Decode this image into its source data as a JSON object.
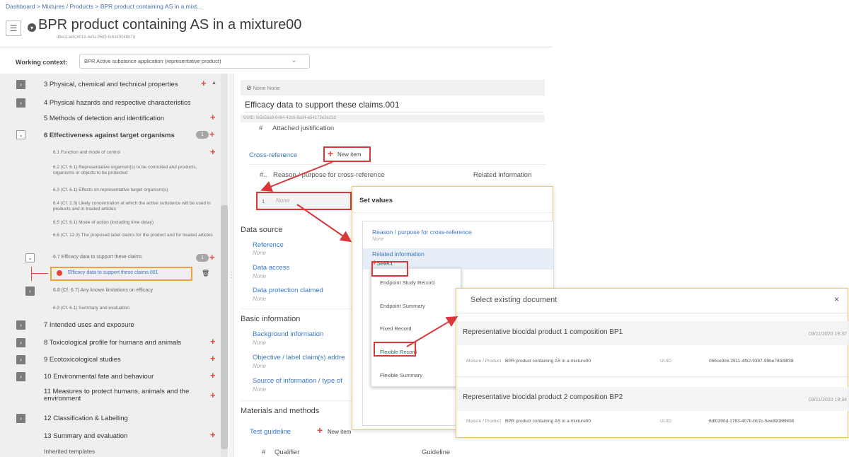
{
  "header": {
    "breadcrumb": "Dashboard > Mixtures / Products > BPR product containing AS in a mixt...",
    "title": "BPR product containing AS in a mixture00",
    "uuid": "d8ec1ae5-8018-4efa-9589-fe644004bb7d"
  },
  "context": {
    "label": "Working context:",
    "value": "BPR Active substance application (representative product)"
  },
  "sidebar": {
    "items": [
      {
        "label": "3 Physical, chemical and technical properties"
      },
      {
        "label": "4 Physical hazards and respective characteristics"
      },
      {
        "label": "5 Methods of detection and identification"
      },
      {
        "label": "6 Effectiveness against target organisms",
        "badge": "1"
      },
      {
        "label": "6.1 Function and mode of control"
      },
      {
        "label": "6.2 (Cf. 6.1) Representative organism(s) to be controlled and products, organisms or objects to be protected"
      },
      {
        "label": "6.3 (Cf. 6.1) Effects on representative target organism(s)"
      },
      {
        "label": "6.4 (Cf. 2.3) Likely concentration at which the active substance will be used in products and in treated articles"
      },
      {
        "label": "6.5 (Cf. 6.1) Mode of action (including time delay)"
      },
      {
        "label": "6.6 (Cf. 12.3) The proposed label claims for the product and for treated articles"
      },
      {
        "label": "6.7 Efficacy data to support these claims",
        "badge": "1"
      },
      {
        "label": "Efficacy data to support these claims.001"
      },
      {
        "label": "6.8 (Cf. 6.7) Any known limitations on efficacy"
      },
      {
        "label": "6.9 (Cf. 6.1) Summary and evaluation"
      },
      {
        "label": "7 Intended uses and exposure"
      },
      {
        "label": "8 Toxicological profile for humans and animals"
      },
      {
        "label": "9 Ecotoxicological studies"
      },
      {
        "label": "10 Environmental fate and behaviour"
      },
      {
        "label": "11 Measures to protect humans, animals and the environment"
      },
      {
        "label": "12 Classification & Labelling"
      },
      {
        "label": "13 Summary and evaluation"
      },
      {
        "label": "Inherited templates"
      }
    ]
  },
  "main": {
    "strip": "None None",
    "doc_title": "Efficacy data to support these claims.001",
    "doc_uuid": "UUID: fe5b5ba9-6464-42c6-8a34-e54172e2e21d",
    "attached_hash": "#",
    "attached": "Attached justification",
    "cross_ref": "Cross-reference",
    "new_item": "New item",
    "col_hash": "#..",
    "col_reason": "Reason / purpose for cross-reference",
    "col_related": "Related information",
    "row_num": "1",
    "row_none": "None",
    "data_source": "Data source",
    "reference": "Reference",
    "data_access": "Data access",
    "data_protection": "Data protection claimed",
    "basic_info": "Basic information",
    "background": "Background information",
    "objective": "Objective / label claim(s) addre",
    "source_info": "Source of information / type of",
    "materials": "Materials and methods",
    "test_guideline": "Test guideline",
    "col_qualifier": "Qualifier",
    "col_guideline": "Guideline",
    "none": "None"
  },
  "set_values": {
    "title": "Set values",
    "reason": "Reason / purpose for cross-reference",
    "related": "Related information",
    "select": "Select",
    "options": [
      "Endpoint Study Record",
      "Endpoint Summary",
      "Fixed Record",
      "Flexible Record",
      "Flexible Summary"
    ]
  },
  "select_doc": {
    "title": "Select existing document",
    "close": "×",
    "docs": [
      {
        "name": "Representative biocidal product 1 composition BP1",
        "date": "03/11/2020 19:37",
        "type_label": "Mixture / Product",
        "type_value": "BPR product containing AS in a mixture00",
        "uuid_label": "UUID",
        "uuid": "066ce9c6-2611-4fb2-9387-99be784d8f38"
      },
      {
        "name": "Representative biocidal product 2 composition BP2",
        "date": "03/11/2020 19:34",
        "type_label": "Mixture / Product",
        "type_value": "BPR product containing AS in a mixture00",
        "uuid_label": "UUID",
        "uuid": "6df0390d-1783-407b-bb7c-5ee89086f498"
      }
    ]
  },
  "colors": {
    "accent": "#e8463a",
    "link": "#3a78c2",
    "highlight_red": "#d9383a",
    "highlight_orange": "#e7a43c"
  }
}
